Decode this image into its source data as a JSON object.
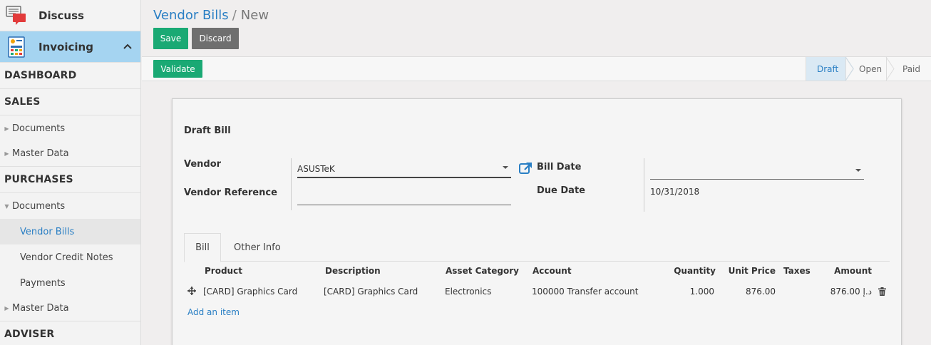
{
  "sidebar": {
    "apps": [
      {
        "label": "Discuss"
      },
      {
        "label": "Invoicing"
      }
    ],
    "dashboard": "DASHBOARD",
    "sales": "SALES",
    "sales_items": [
      "Documents",
      "Master Data"
    ],
    "purchases": "PURCHASES",
    "purchases_documents": "Documents",
    "purchases_sub": [
      "Vendor Bills",
      "Vendor Credit Notes",
      "Payments"
    ],
    "purchases_master": "Master Data",
    "adviser": "ADVISER"
  },
  "header": {
    "breadcrumb_parent": "Vendor Bills",
    "breadcrumb_sep": "/",
    "breadcrumb_current": "New",
    "save_label": "Save",
    "discard_label": "Discard"
  },
  "statusbar": {
    "validate_label": "Validate",
    "stages": [
      "Draft",
      "Open",
      "Paid"
    ],
    "current_stage": "Draft"
  },
  "form": {
    "title": "Draft Bill",
    "vendor_label": "Vendor",
    "vendor_value": "ASUSTeK",
    "vendor_ref_label": "Vendor Reference",
    "vendor_ref_value": "",
    "bill_date_label": "Bill Date",
    "bill_date_value": "",
    "due_date_label": "Due Date",
    "due_date_value": "10/31/2018"
  },
  "tabs": [
    "Bill",
    "Other Info"
  ],
  "lines": {
    "columns": [
      "Product",
      "Description",
      "Asset Category",
      "Account",
      "Quantity",
      "Unit Price",
      "Taxes",
      "Amount"
    ],
    "rows": [
      {
        "product": "[CARD] Graphics Card",
        "description": "[CARD] Graphics Card",
        "asset_category": "Electronics",
        "account": "100000 Transfer account",
        "quantity": "1.000",
        "unit_price": "876.00",
        "taxes": "",
        "amount": "876.00 د.إ"
      }
    ],
    "add_item": "Add an item"
  },
  "colors": {
    "primary_green": "#1aa974",
    "link_blue": "#2a7fc4",
    "active_app_bg": "#a5d4f1"
  }
}
